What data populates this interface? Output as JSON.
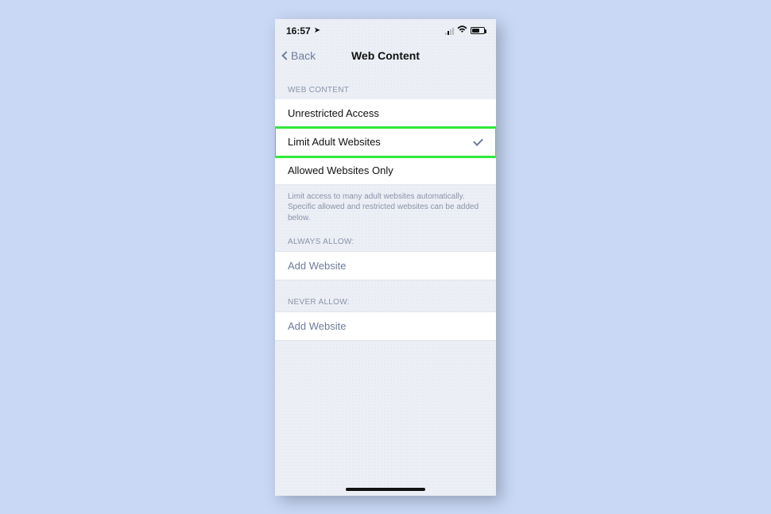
{
  "statusbar": {
    "time": "16:57"
  },
  "nav": {
    "back": "Back",
    "title": "Web Content"
  },
  "section1": {
    "header": "WEB CONTENT",
    "options": [
      {
        "label": "Unrestricted Access"
      },
      {
        "label": "Limit Adult Websites",
        "selected": true
      },
      {
        "label": "Allowed Websites Only"
      }
    ],
    "footer": "Limit access to many adult websites automatically. Specific allowed and restricted websites can be added below."
  },
  "section2": {
    "header": "ALWAYS ALLOW:",
    "add": "Add Website"
  },
  "section3": {
    "header": "NEVER ALLOW:",
    "add": "Add Website"
  }
}
